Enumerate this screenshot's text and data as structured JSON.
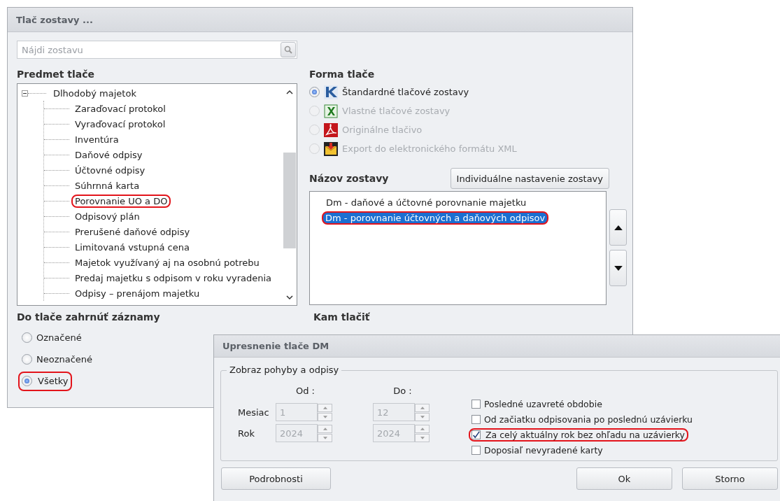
{
  "main_window": {
    "title": "Tlač zostavy ...",
    "search": {
      "placeholder": "Nájdi zostavu"
    },
    "subject": {
      "label": "Predmet tlače",
      "tree": [
        {
          "label": "Dlhodobý majetok",
          "expanded": true,
          "children": [
            {
              "label": "Zaraďovací protokol",
              "circled": false
            },
            {
              "label": "Vyraďovací protokol",
              "circled": false
            },
            {
              "label": "Inventúra",
              "circled": false
            },
            {
              "label": "Daňové odpisy",
              "circled": false
            },
            {
              "label": "Účtovné odpisy",
              "circled": false
            },
            {
              "label": "Súhrnná karta",
              "circled": false
            },
            {
              "label": "Porovnanie UO a DO",
              "circled": true
            },
            {
              "label": "Odpisový plán",
              "circled": false
            },
            {
              "label": "Prerušené daňové odpisy",
              "circled": false
            },
            {
              "label": "Limitovaná vstupná cena",
              "circled": false
            },
            {
              "label": "Majetok využívaný aj na osobnú potrebu",
              "circled": false
            },
            {
              "label": "Predaj majetku s odpisom v roku vyradenia",
              "circled": false
            },
            {
              "label": "Odpisy – prenájom majetku",
              "circled": false
            }
          ]
        }
      ]
    },
    "print_form": {
      "label": "Forma tlače",
      "options": [
        {
          "label": "Štandardné tlačové zostavy",
          "selected": true,
          "disabled": false,
          "kind": "logo"
        },
        {
          "label": "Vlastné tlačové zostavy",
          "selected": false,
          "disabled": true,
          "kind": "spreadsheet"
        },
        {
          "label": "Originálne tlačivo",
          "selected": false,
          "disabled": true,
          "kind": "pdf"
        },
        {
          "label": "Export do elektronického formátu XML",
          "selected": false,
          "disabled": true,
          "kind": "export"
        }
      ]
    },
    "report_name": {
      "label": "Názov zostavy",
      "button": "Individuálne nastavenie zostavy",
      "items": [
        {
          "label": "Dm - daňové a účtovné porovnanie majetku",
          "selected": false,
          "circled": false
        },
        {
          "label": "Dm - porovnanie účtovných a daňových odpisov",
          "selected": true,
          "circled": true
        }
      ]
    },
    "records": {
      "label": "Do tlače zahrnúť záznamy",
      "options": [
        {
          "label": "Označené",
          "selected": false,
          "circled": false
        },
        {
          "label": "Neoznačené",
          "selected": false,
          "circled": false
        },
        {
          "label": "Všetky",
          "selected": true,
          "circled": true
        }
      ]
    },
    "destination": {
      "label": "Kam tlačiť"
    }
  },
  "detail_dialog": {
    "title": "Upresnenie tlače DM",
    "group": {
      "legend": "Zobraz pohyby a odpisy",
      "from_label": "Od :",
      "to_label": "Do :",
      "rows": [
        {
          "label": "Mesiac",
          "from": "1",
          "to": "12"
        },
        {
          "label": "Rok",
          "from": "2024",
          "to": "2024"
        }
      ],
      "checks": [
        {
          "label": "Posledné uzavreté obdobie",
          "checked": false,
          "circled": false
        },
        {
          "label": "Od začiatku odpisovania po poslednú uzávierku",
          "checked": false,
          "circled": false
        },
        {
          "label": "Za celý aktuálny rok bez ohľadu na uzávierky",
          "checked": true,
          "circled": true
        },
        {
          "label": "Doposiaľ nevyradené karty",
          "checked": false,
          "circled": false
        }
      ]
    },
    "buttons": [
      {
        "label": "Podrobnosti"
      },
      {
        "label": "Ok"
      },
      {
        "label": "Storno"
      }
    ]
  }
}
